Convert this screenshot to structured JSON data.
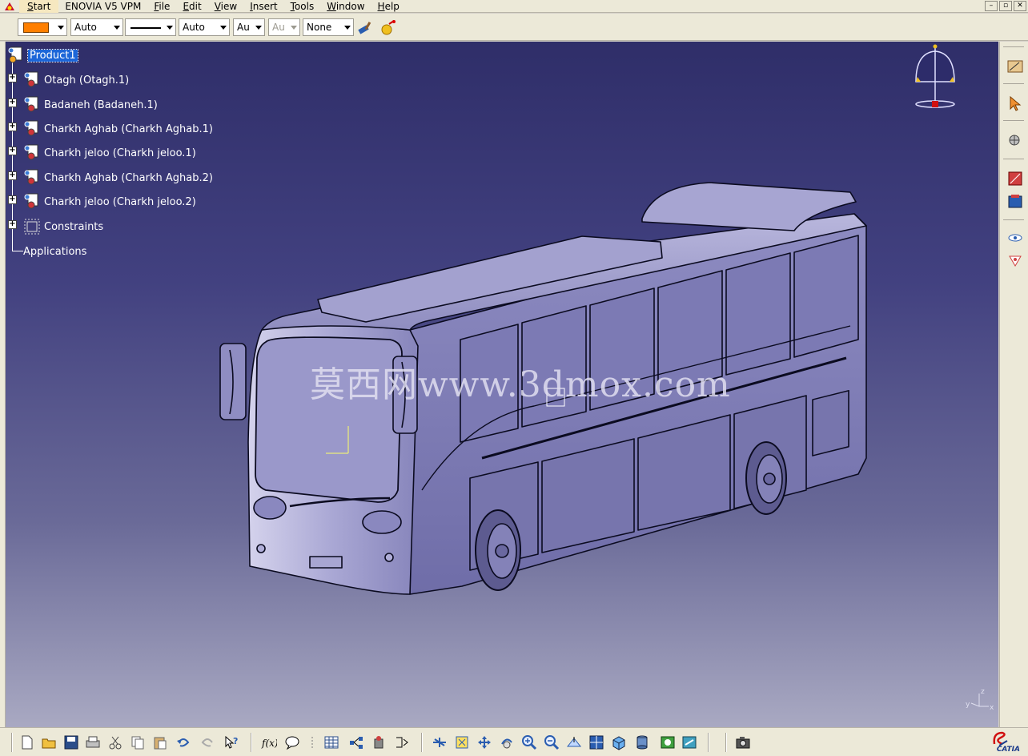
{
  "menubar": {
    "items": [
      {
        "label": "Start",
        "mnemonic": "S",
        "rest": "tart"
      },
      {
        "label": "ENOVIA V5 VPM",
        "mnemonic": "",
        "rest": "ENOVIA V5 VPM"
      },
      {
        "label": "File",
        "mnemonic": "F",
        "rest": "ile"
      },
      {
        "label": "Edit",
        "mnemonic": "E",
        "rest": "dit"
      },
      {
        "label": "View",
        "mnemonic": "V",
        "rest": "iew"
      },
      {
        "label": "Insert",
        "mnemonic": "I",
        "rest": "nsert"
      },
      {
        "label": "Tools",
        "mnemonic": "T",
        "rest": "ools"
      },
      {
        "label": "Window",
        "mnemonic": "W",
        "rest": "indow"
      },
      {
        "label": "Help",
        "mnemonic": "H",
        "rest": "elp"
      }
    ],
    "window_controls": [
      "–",
      "▫",
      "✕"
    ]
  },
  "format_toolbar": {
    "fill_color": "#ff7f00",
    "transparency_value": "Auto",
    "line_thickness_value": "Auto",
    "line_type_value": "Au",
    "point_type_value": "Au",
    "layer_value": "None"
  },
  "tree": {
    "root": "Product1",
    "children": [
      "Otagh (Otagh.1)",
      "Badaneh (Badaneh.1)",
      "Charkh Aghab (Charkh Aghab.1)",
      "Charkh jeloo (Charkh jeloo.1)",
      "Charkh Aghab (Charkh Aghab.2)",
      "Charkh jeloo (Charkh jeloo.2)",
      "Constraints"
    ],
    "applications": "Applications"
  },
  "viewport": {
    "watermark": "莫西网www.3dmox.com",
    "axis_labels": {
      "z": "z",
      "y": "y",
      "x": "x"
    },
    "gradient_top": "#2f2e69",
    "gradient_bottom": "#a9a9c2"
  },
  "right_toolbar": {
    "icons": [
      "sketch-icon",
      "select-icon",
      "snap-icon",
      "catalog-icon",
      "render-icon",
      "hide-show-icon",
      "swap-visible-icon"
    ]
  },
  "bottom_toolbar": {
    "icons": [
      "new-icon",
      "open-icon",
      "save-icon",
      "print-icon",
      "cut-icon",
      "copy-icon",
      "paste-icon",
      "undo-icon",
      "redo-icon",
      "whats-this-icon",
      "formula-icon",
      "comment-icon",
      "knowledge-icon",
      "table-icon",
      "tree-icon",
      "tools-icon",
      "measure-icon",
      "fly-mode-icon",
      "fit-all-icon",
      "pan-icon",
      "rotate-icon",
      "zoom-in-icon",
      "zoom-out-icon",
      "normal-view-icon",
      "multi-view-icon",
      "iso-view-icon",
      "view-mode-icon",
      "hide-icon",
      "swap-icon",
      "capture-icon"
    ],
    "brand": "CATIA"
  }
}
